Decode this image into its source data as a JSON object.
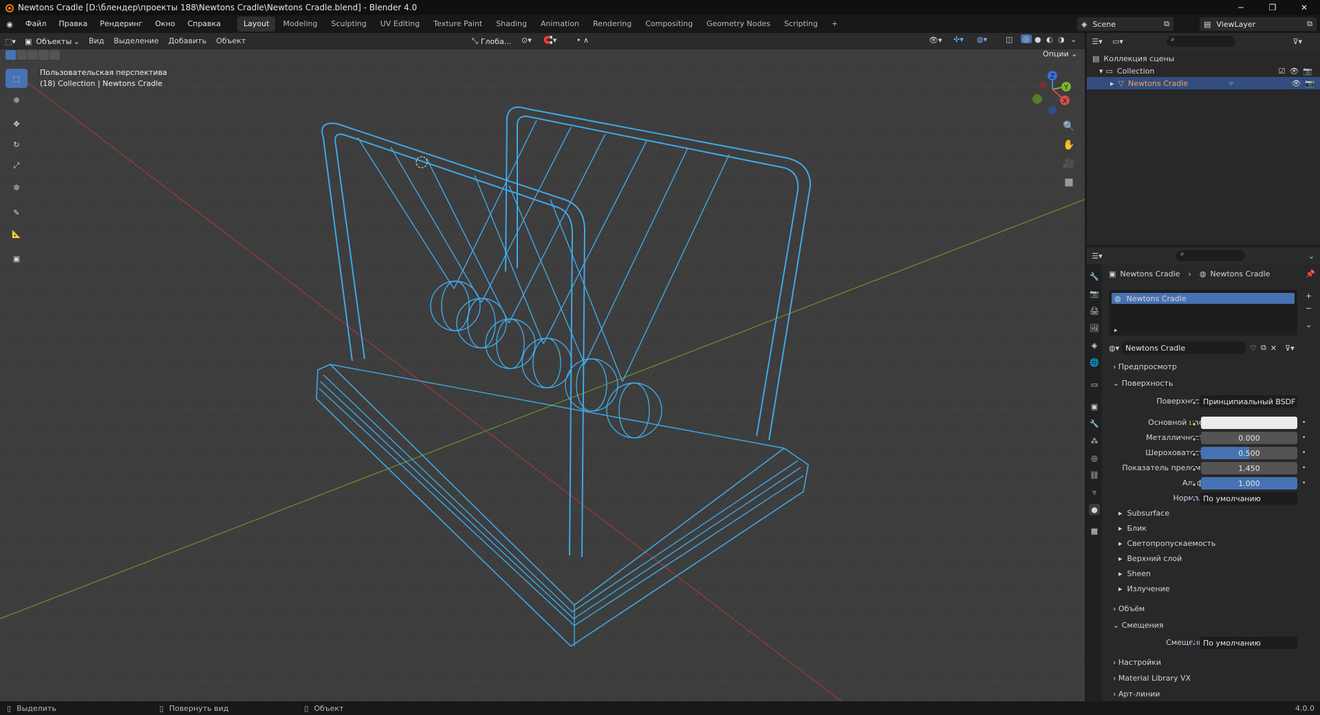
{
  "window": {
    "title": "Newtons Cradle [D:\\блендер\\проекты 188\\Newtons Cradle\\Newtons Cradle.blend] - Blender 4.0"
  },
  "menu": [
    "Файл",
    "Правка",
    "Рендеринг",
    "Окно",
    "Справка"
  ],
  "workspaces": [
    "Layout",
    "Modeling",
    "Sculpting",
    "UV Editing",
    "Texture Paint",
    "Shading",
    "Animation",
    "Rendering",
    "Compositing",
    "Geometry Nodes",
    "Scripting"
  ],
  "active_workspace": "Layout",
  "scene_name": "Scene",
  "view_layer": "ViewLayer",
  "viewport_header": {
    "mode": "Объекты",
    "menus": [
      "Вид",
      "Выделение",
      "Добавить",
      "Объект"
    ],
    "orientation": "Глоба...",
    "options": "Опции"
  },
  "viewport_overlay": {
    "view_name": "Пользовательская перспектива",
    "collection_info": "(18) Collection | Newtons Cradle"
  },
  "gizmo": {
    "x": "X",
    "y": "Y",
    "z": "Z"
  },
  "outliner": {
    "root": "Коллекция сцены",
    "collection": "Collection",
    "object": "Newtons Cradle"
  },
  "properties": {
    "breadcrumb_object": "Newtons Cradle",
    "breadcrumb_material": "Newtons Cradle",
    "slot": "Newtons Cradle",
    "material_name": "Newtons Cradle",
    "sections": {
      "preview": "Предпросмотр",
      "surface": "Поверхность",
      "volume": "Объём",
      "displacement": "Смещения",
      "settings": "Настройки",
      "material_library": "Material Library VX",
      "lineart": "Арт-линии"
    },
    "surface_label": "Поверхность",
    "surface_value": "Принципиальный BSDF",
    "params": [
      {
        "label": "Основной цвет",
        "value": ""
      },
      {
        "label": "Металличность",
        "value": "0.000"
      },
      {
        "label": "Шероховатость",
        "value": "0.500"
      },
      {
        "label": "Показатель прелом...",
        "value": "1.450"
      },
      {
        "label": "Альфа",
        "value": "1.000"
      }
    ],
    "normal_label": "Нормаль",
    "normal_value": "По умолчанию",
    "subpanels": [
      "Subsurface",
      "Блик",
      "Светопропускаемость",
      "Верхний слой",
      "Sheen",
      "Излучение"
    ],
    "displacement_label": "Смещения",
    "displacement_value": "По умолчанию"
  },
  "status_bar": {
    "select": "Выделить",
    "rotate": "Повернуть вид",
    "object": "Объект",
    "version": "4.0.0"
  },
  "colors": {
    "accent": "#4772b3",
    "wire": "#3fa9e8",
    "viewport_bg": "#3d3d3d"
  }
}
